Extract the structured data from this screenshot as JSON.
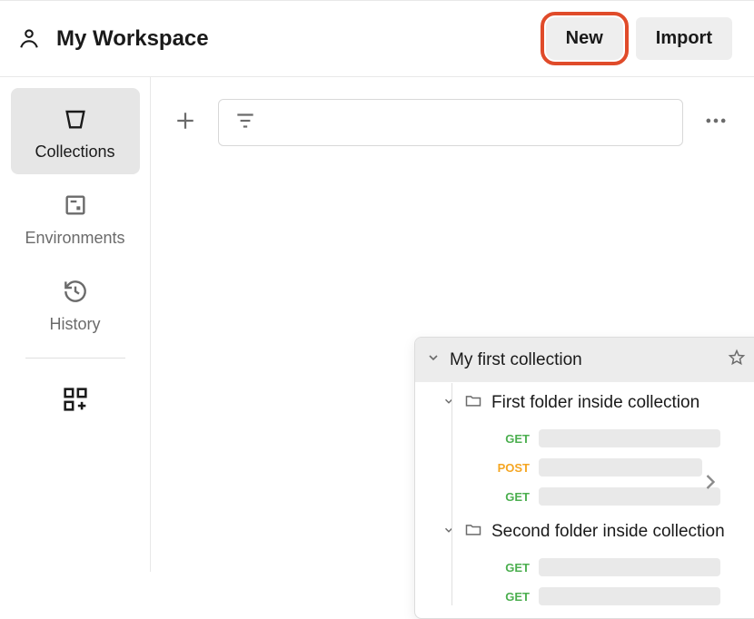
{
  "header": {
    "workspace_title": "My Workspace",
    "new_button": "New",
    "import_button": "Import"
  },
  "sidebar": {
    "items": [
      {
        "label": "Collections",
        "icon": "collections-icon",
        "active": true
      },
      {
        "label": "Environments",
        "icon": "environments-icon",
        "active": false
      },
      {
        "label": "History",
        "icon": "history-icon",
        "active": false
      }
    ]
  },
  "collection": {
    "name": "My first collection",
    "folders": [
      {
        "name": "First folder inside collection",
        "requests": [
          {
            "method": "GET"
          },
          {
            "method": "POST"
          },
          {
            "method": "GET"
          }
        ]
      },
      {
        "name": "Second folder inside collection",
        "requests": [
          {
            "method": "GET"
          },
          {
            "method": "GET"
          }
        ]
      }
    ]
  }
}
